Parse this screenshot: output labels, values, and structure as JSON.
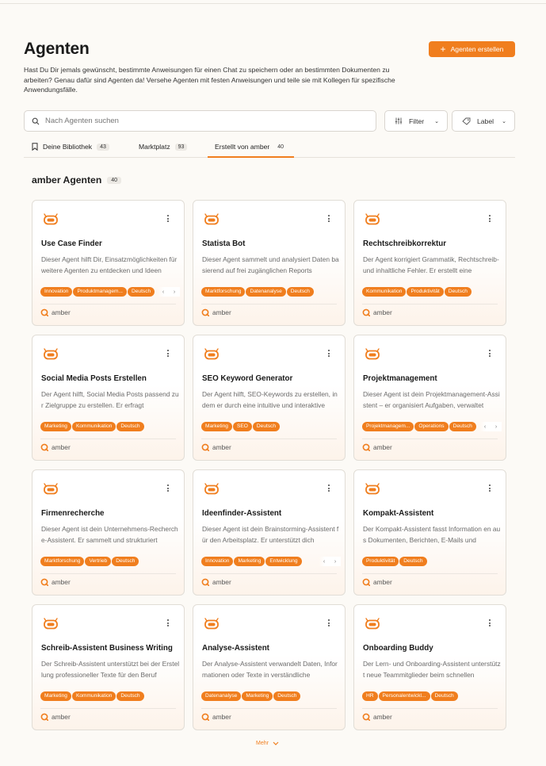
{
  "header": {
    "title": "Agenten",
    "description": "Hast Du Dir jemals gewünscht, bestimmte Anweisungen für einen Chat zu speichern oder an bestimmten Dokumenten zu arbeiten? Genau dafür sind Agenten da! Versehe Agenten mit festen Anweisungen und teile sie mit Kollegen für spezifische Anwendungsfälle.",
    "create_button": "Agenten erstellen"
  },
  "search": {
    "placeholder": "Nach Agenten suchen",
    "value": ""
  },
  "filters": {
    "filter_label": "Filter",
    "label_label": "Label"
  },
  "tabs": [
    {
      "label": "Deine Bibliothek",
      "count": "43"
    },
    {
      "label": "Marktplatz",
      "count": "93"
    },
    {
      "label": "Erstellt von amber",
      "count": "40"
    }
  ],
  "section": {
    "title": "amber Agenten",
    "count": "40"
  },
  "cards": [
    {
      "title": "Use Case Finder",
      "desc": "Dieser Agent hilft Dir, Einsatzmöglichkeiten für weitere Agenten zu entdecken und Ideen",
      "tags": [
        "Innovation",
        "Produktmanagem...",
        "Deutsch"
      ],
      "owner": "amber",
      "arrows": true
    },
    {
      "title": "Statista Bot",
      "desc": "Dieser Agent sammelt und analysiert Daten basierend auf frei zugänglichen Reports",
      "tags": [
        "Marktforschung",
        "Datenanalyse",
        "Deutsch"
      ],
      "owner": "amber",
      "arrows": false
    },
    {
      "title": "Rechtschreibkorrektur",
      "desc": "Der Agent korrigiert Grammatik, Rechtschreib- und inhaltliche Fehler. Er erstellt eine",
      "tags": [
        "Kommunikation",
        "Produktivität",
        "Deutsch"
      ],
      "owner": "amber",
      "arrows": false
    },
    {
      "title": "Social Media Posts Erstellen",
      "desc": "Der Agent hilft, Social Media Posts passend zur Zielgruppe zu erstellen. Er erfragt",
      "tags": [
        "Marketing",
        "Kommunikation",
        "Deutsch"
      ],
      "owner": "amber",
      "arrows": false
    },
    {
      "title": "SEO Keyword Generator",
      "desc": "Der Agent hilft, SEO-Keywords zu erstellen, indem er durch eine intuitive und interaktive",
      "tags": [
        "Marketing",
        "SEO",
        "Deutsch"
      ],
      "owner": "amber",
      "arrows": false
    },
    {
      "title": "Projektmanagement",
      "desc": "Dieser Agent ist dein Projektmanagement-Assistent – er organisiert Aufgaben, verwaltet",
      "tags": [
        "Projektmanagem...",
        "Operations",
        "Deutsch"
      ],
      "owner": "amber",
      "arrows": true
    },
    {
      "title": "Firmenrecherche",
      "desc": "Dieser Agent ist dein Unternehmens-Recherche-Assistent. Er sammelt und strukturiert",
      "tags": [
        "Marktforschung",
        "Vertrieb",
        "Deutsch"
      ],
      "owner": "amber",
      "arrows": false
    },
    {
      "title": "Ideenfinder-Assistent",
      "desc": "Dieser Agent ist dein Brainstorming-Assistent für den Arbeitsplatz. Er unterstützt dich",
      "tags": [
        "Innovation",
        "Marketing",
        "Entwicklung"
      ],
      "owner": "amber",
      "arrows": true
    },
    {
      "title": "Kompakt-Assistent",
      "desc": "Der Kompakt-Assistent fasst Information en aus Dokumenten, Berichten, E-Mails und",
      "tags": [
        "Produktivität",
        "Deutsch"
      ],
      "owner": "amber",
      "arrows": false
    },
    {
      "title": "Schreib-Assistent Business Writing",
      "desc": "Der Schreib-Assistent unterstützt bei der Erstellung professioneller Texte für den Beruf",
      "tags": [
        "Marketing",
        "Kommunikation",
        "Deutsch"
      ],
      "owner": "amber",
      "arrows": false
    },
    {
      "title": "Analyse-Assistent",
      "desc": "Der Analyse-Assistent verwandelt Daten, Informationen oder Texte in verständliche",
      "tags": [
        "Datenanalyse",
        "Marketing",
        "Deutsch"
      ],
      "owner": "amber",
      "arrows": false
    },
    {
      "title": "Onboarding Buddy",
      "desc": "Der Lern- und Onboarding-Assistent unterstützt neue Teammitglieder beim schnellen",
      "tags": [
        "HR",
        "Personalentwickl...",
        "Deutsch"
      ],
      "owner": "amber",
      "arrows": false
    }
  ],
  "more": "Mehr",
  "colors": {
    "accent": "#f07e1e",
    "background": "#fcfaf6"
  },
  "icons": [
    "plus-icon",
    "search-icon",
    "filter-icon",
    "tag-icon",
    "bookmark-icon",
    "robot-icon",
    "kebab-icon",
    "amber-logo-icon",
    "chevron-down-icon"
  ]
}
